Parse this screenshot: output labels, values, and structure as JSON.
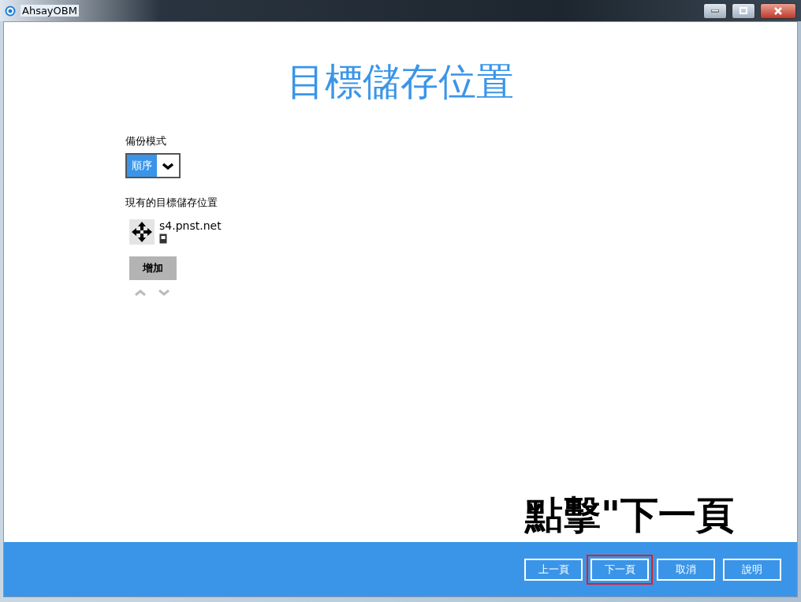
{
  "window": {
    "title": "AhsayOBM"
  },
  "heading": "目標儲存位置",
  "backup_mode": {
    "label": "備份模式",
    "value": "順序"
  },
  "destinations": {
    "label": "現有的目標儲存位置",
    "items": [
      {
        "name": "s4.pnst.net"
      }
    ],
    "add_button": "增加"
  },
  "annotation": "點擊\"下一頁",
  "buttons": [
    {
      "label": "上一頁",
      "highlighted": false
    },
    {
      "label": "下一頁",
      "highlighted": true
    },
    {
      "label": "取消",
      "highlighted": false
    },
    {
      "label": "說明",
      "highlighted": false
    }
  ]
}
